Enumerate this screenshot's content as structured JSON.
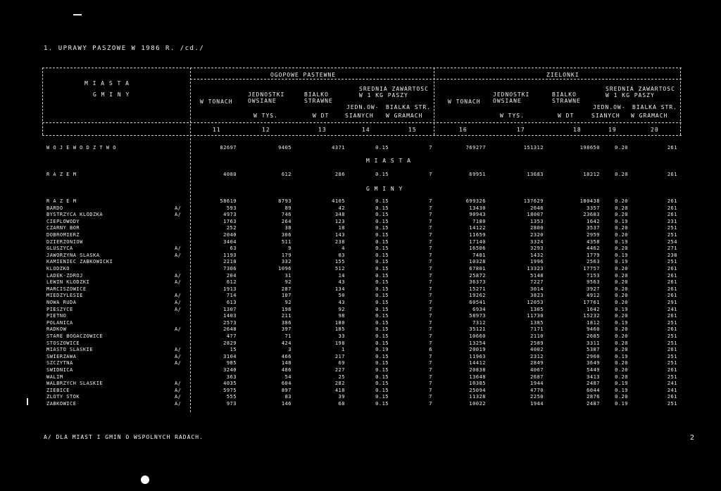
{
  "heading": "1. UPRAWY PASZOWE W 1986 R. /cd./",
  "footnote": "A/ DLA MIAST I GMIN O WSPOLNYCH RADACH.",
  "page_mark": "2",
  "header": {
    "col_region_1": "M I A S T A",
    "col_region_2": "G M I N Y",
    "group_left": "OGOPOWE PASTEWNE",
    "group_right": "ZIELONKI",
    "w_tonach": "W TONACH",
    "jedn_owsiane": "JEDNOSTKI OWSIANE",
    "bialko": "BIALKO STRAWNE",
    "srednia": "SREDNIA ZAWARTOSC W 1 KG PASZY",
    "jedn_zb": "JEDN.OW-",
    "bialka_str": "BIALKA STR.",
    "w_tys": "W TYS.",
    "w_dt": "W DT",
    "siannych": "SIANYCH",
    "w_gramach": "W GRAMACH",
    "col_nums": [
      "11",
      "12",
      "13",
      "14",
      "15",
      "16",
      "17",
      "18",
      "19",
      "20"
    ]
  },
  "sections": {
    "woj": "W O J E W O D Z T W O",
    "miasta": "M I A S T A",
    "gminy": "G M I N Y"
  },
  "totals": [
    {
      "name": "W O J E W O D Z T W O",
      "c11": "82697",
      "c12": "9405",
      "c13": "4371",
      "c14": "0.15",
      "c15": "7",
      "c16": "769277",
      "c17": "151312",
      "c18": "198650",
      "c19": "0.20",
      "c20": "261"
    },
    {
      "name": "R A Z E M",
      "c11": "4080",
      "c12": "612",
      "c13": "286",
      "c14": "0.15",
      "c15": "7",
      "c16": "69951",
      "c17": "13683",
      "c18": "18212",
      "c19": "0.20",
      "c20": "261"
    }
  ],
  "rows": [
    {
      "name": "R A Z E M",
      "fn": "",
      "c11": "58619",
      "c12": "8793",
      "c13": "4105",
      "c14": "0.15",
      "c15": "7",
      "c16": "699326",
      "c17": "137629",
      "c18": "180438",
      "c19": "0.20",
      "c20": "261"
    },
    {
      "name": "BARDO",
      "fn": "A/",
      "c11": "593",
      "c12": "89",
      "c13": "42",
      "c14": "0.15",
      "c15": "7",
      "c16": "13430",
      "c17": "2646",
      "c18": "3357",
      "c19": "0.20",
      "c20": "261"
    },
    {
      "name": "BYSTRZYCA KLODZKA",
      "fn": "A/",
      "c11": "4973",
      "c12": "746",
      "c13": "348",
      "c14": "0.15",
      "c15": "7",
      "c16": "90943",
      "c17": "18007",
      "c18": "23683",
      "c19": "0.20",
      "c20": "261"
    },
    {
      "name": "CIEPLOWODY",
      "fn": "",
      "c11": "1763",
      "c12": "264",
      "c13": "123",
      "c14": "0.15",
      "c15": "7",
      "c16": "7180",
      "c17": "1353",
      "c18": "1642",
      "c19": "0.19",
      "c20": "231"
    },
    {
      "name": "CZARNY BOR",
      "fn": "",
      "c11": "252",
      "c12": "38",
      "c13": "18",
      "c14": "0.15",
      "c15": "7",
      "c16": "14122",
      "c17": "2800",
      "c18": "3537",
      "c19": "0.20",
      "c20": "251"
    },
    {
      "name": "DOBROMIERZ",
      "fn": "",
      "c11": "2040",
      "c12": "306",
      "c13": "143",
      "c14": "0.15",
      "c15": "7",
      "c16": "11659",
      "c17": "2320",
      "c18": "2959",
      "c19": "0.20",
      "c20": "251"
    },
    {
      "name": "DZIERZONIOW",
      "fn": "",
      "c11": "3404",
      "c12": "511",
      "c13": "238",
      "c14": "0.15",
      "c15": "7",
      "c16": "17140",
      "c17": "3324",
      "c18": "4358",
      "c19": "0.19",
      "c20": "254"
    },
    {
      "name": "GLUSZYCA",
      "fn": "A/",
      "c11": "63",
      "c12": "9",
      "c13": "4",
      "c14": "0.15",
      "c15": "7",
      "c16": "16506",
      "c17": "3293",
      "c18": "4462",
      "c19": "0.20",
      "c20": "271"
    },
    {
      "name": "JAWORZYNA SLASKA",
      "fn": "A/",
      "c11": "1193",
      "c12": "179",
      "c13": "83",
      "c14": "0.15",
      "c15": "7",
      "c16": "7481",
      "c17": "1432",
      "c18": "1779",
      "c19": "0.19",
      "c20": "238"
    },
    {
      "name": "KAMIENIEC ZABKOWICKI",
      "fn": "",
      "c11": "2210",
      "c12": "332",
      "c13": "155",
      "c14": "0.15",
      "c15": "7",
      "c16": "10328",
      "c17": "1996",
      "c18": "2563",
      "c19": "0.19",
      "c20": "251"
    },
    {
      "name": "KLODZKO",
      "fn": "",
      "c11": "7306",
      "c12": "1096",
      "c13": "512",
      "c14": "0.15",
      "c15": "7",
      "c16": "67801",
      "c17": "13323",
      "c18": "17757",
      "c19": "0.20",
      "c20": "261"
    },
    {
      "name": "LADEK-ZDROJ",
      "fn": "A/",
      "c11": "204",
      "c12": "31",
      "c13": "14",
      "c14": "0.15",
      "c15": "7",
      "c16": "25872",
      "c17": "5148",
      "c18": "7153",
      "c19": "0.20",
      "c20": "261"
    },
    {
      "name": "LEWIN KLODZKI",
      "fn": "A/",
      "c11": "612",
      "c12": "92",
      "c13": "43",
      "c14": "0.15",
      "c15": "7",
      "c16": "36373",
      "c17": "7227",
      "c18": "9563",
      "c19": "0.20",
      "c20": "261"
    },
    {
      "name": "MARCISZOWICE",
      "fn": "",
      "c11": "1913",
      "c12": "287",
      "c13": "134",
      "c14": "0.15",
      "c15": "7",
      "c16": "15271",
      "c17": "3014",
      "c18": "3927",
      "c19": "0.20",
      "c20": "261"
    },
    {
      "name": "MIEDZYLESIE",
      "fn": "A/",
      "c11": "714",
      "c12": "107",
      "c13": "50",
      "c14": "0.15",
      "c15": "7",
      "c16": "19262",
      "c17": "3823",
      "c18": "4912",
      "c19": "0.20",
      "c20": "261"
    },
    {
      "name": "NOWA RUDA",
      "fn": "A/",
      "c11": "613",
      "c12": "92",
      "c13": "43",
      "c14": "0.15",
      "c15": "7",
      "c16": "60541",
      "c17": "12053",
      "c18": "17761",
      "c19": "0.20",
      "c20": "291"
    },
    {
      "name": "PIESZYCE",
      "fn": "A/",
      "c11": "1307",
      "c12": "196",
      "c13": "92",
      "c14": "0.15",
      "c15": "7",
      "c16": "6934",
      "c17": "1305",
      "c18": "1642",
      "c19": "0.19",
      "c20": "241"
    },
    {
      "name": "PIETNO",
      "fn": "",
      "c11": "1403",
      "c12": "211",
      "c13": "98",
      "c14": "0.15",
      "c15": "7",
      "c16": "58973",
      "c17": "11730",
      "c18": "15232",
      "c19": "0.20",
      "c20": "261"
    },
    {
      "name": "POLANICA",
      "fn": "",
      "c11": "2573",
      "c12": "386",
      "c13": "180",
      "c14": "0.15",
      "c15": "7",
      "c16": "7312",
      "c17": "1385",
      "c18": "1812",
      "c19": "0.19",
      "c20": "251"
    },
    {
      "name": "RADKOW",
      "fn": "A/",
      "c11": "2648",
      "c12": "397",
      "c13": "185",
      "c14": "0.15",
      "c15": "7",
      "c16": "35121",
      "c17": "7171",
      "c18": "9460",
      "c19": "0.20",
      "c20": "261"
    },
    {
      "name": "STARE BOGACZOWICE",
      "fn": "",
      "c11": "477",
      "c12": "71",
      "c13": "33",
      "c14": "0.15",
      "c15": "7",
      "c16": "10660",
      "c17": "2110",
      "c18": "2685",
      "c19": "0.20",
      "c20": "251"
    },
    {
      "name": "STOSZOWICE",
      "fn": "",
      "c11": "2829",
      "c12": "424",
      "c13": "198",
      "c14": "0.15",
      "c15": "7",
      "c16": "13254",
      "c17": "2589",
      "c18": "3311",
      "c19": "0.20",
      "c20": "251"
    },
    {
      "name": "MIASTO SLASKIE",
      "fn": "A/",
      "c11": "15",
      "c12": "3",
      "c13": "1",
      "c14": "0.19",
      "c15": "6",
      "c16": "20019",
      "c17": "4002",
      "c18": "5387",
      "c19": "0.20",
      "c20": "261"
    },
    {
      "name": "SWIERZAWA",
      "fn": "A/",
      "c11": "3104",
      "c12": "466",
      "c13": "217",
      "c14": "0.15",
      "c15": "7",
      "c16": "11963",
      "c17": "2312",
      "c18": "2960",
      "c19": "0.19",
      "c20": "251"
    },
    {
      "name": "SZCZYTNA",
      "fn": "A/",
      "c11": "985",
      "c12": "148",
      "c13": "69",
      "c14": "0.15",
      "c15": "7",
      "c16": "14412",
      "c17": "2849",
      "c18": "3649",
      "c19": "0.20",
      "c20": "251"
    },
    {
      "name": "SWIDNICA",
      "fn": "",
      "c11": "3240",
      "c12": "486",
      "c13": "227",
      "c14": "0.15",
      "c15": "7",
      "c16": "20838",
      "c17": "4067",
      "c18": "5449",
      "c19": "0.20",
      "c20": "261"
    },
    {
      "name": "WALIM",
      "fn": "",
      "c11": "363",
      "c12": "54",
      "c13": "25",
      "c14": "0.15",
      "c15": "7",
      "c16": "13648",
      "c17": "2687",
      "c18": "3413",
      "c19": "0.20",
      "c20": "251"
    },
    {
      "name": "WALBRZYCH SLASKIE",
      "fn": "A/",
      "c11": "4035",
      "c12": "604",
      "c13": "282",
      "c14": "0.15",
      "c15": "7",
      "c16": "10385",
      "c17": "1944",
      "c18": "2487",
      "c19": "0.19",
      "c20": "241"
    },
    {
      "name": "ZIEBICE",
      "fn": "A/",
      "c11": "5975",
      "c12": "897",
      "c13": "418",
      "c14": "0.15",
      "c15": "7",
      "c16": "25094",
      "c17": "4770",
      "c18": "6044",
      "c19": "0.19",
      "c20": "241"
    },
    {
      "name": "ZLOTY STOK",
      "fn": "A/",
      "c11": "555",
      "c12": "83",
      "c13": "39",
      "c14": "0.15",
      "c15": "7",
      "c16": "11328",
      "c17": "2250",
      "c18": "2876",
      "c19": "0.20",
      "c20": "261"
    },
    {
      "name": "ZABKOWICE",
      "fn": "A/",
      "c11": "973",
      "c12": "146",
      "c13": "68",
      "c14": "0.15",
      "c15": "7",
      "c16": "10022",
      "c17": "1944",
      "c18": "2487",
      "c19": "0.19",
      "c20": "251"
    }
  ]
}
